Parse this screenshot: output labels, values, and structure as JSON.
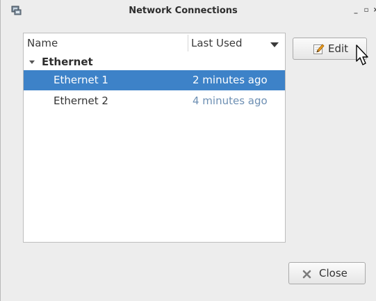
{
  "window": {
    "title": "Network Connections",
    "controls": {
      "minimize": "_",
      "maximize": "▫",
      "close": "×"
    }
  },
  "list": {
    "columns": {
      "name": "Name",
      "last_used": "Last Used"
    },
    "groups": [
      {
        "label": "Ethernet",
        "expanded": true,
        "connections": [
          {
            "name": "Ethernet 1",
            "last_used": "2 minutes ago",
            "selected": true
          },
          {
            "name": "Ethernet 2",
            "last_used": "4 minutes ago",
            "selected": false
          }
        ]
      }
    ]
  },
  "buttons": {
    "edit": {
      "label": "Edit",
      "icon": "edit-pencil-icon"
    },
    "close": {
      "label": "Close",
      "icon": "close-x-icon"
    }
  },
  "colors": {
    "selection": "#3d82c8",
    "timestamp": "#6d8fb3",
    "window_bg": "#ededed"
  }
}
